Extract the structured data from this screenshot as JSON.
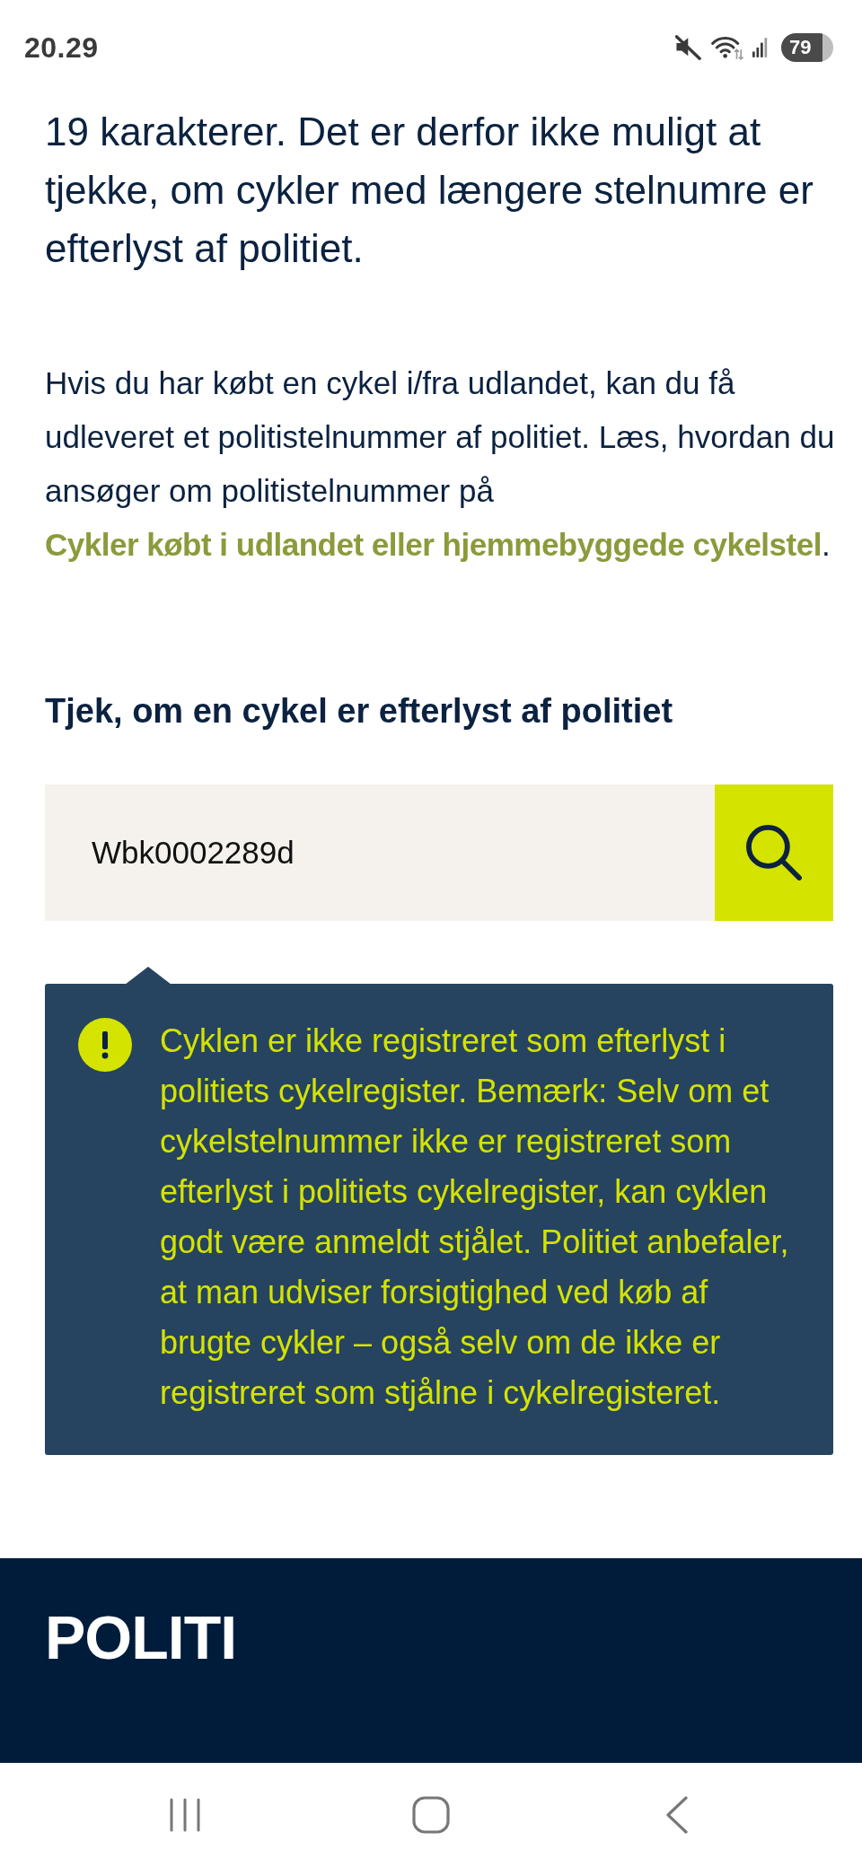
{
  "status_bar": {
    "time": "20.29",
    "battery": "79"
  },
  "intro": {
    "text": "19 karakterer. Det er derfor ikke muligt at tjekke, om cykler med længere stelnumre er efterlyst af politiet."
  },
  "paragraph": {
    "before": "Hvis du har købt en cykel i/fra udlandet, kan du få udleveret et politistelnummer af politiet. Læs, hvordan du ansøger om politistelnummer på",
    "link": "Cykler købt i udlandet eller hjemmebyggede cykelstel",
    "after": "."
  },
  "search": {
    "heading": "Tjek, om en cykel er efterlyst af politiet",
    "value": "Wbk0002289d"
  },
  "alert": {
    "kind": "warning",
    "text": "Cyklen er ikke registreret som efterlyst i politiets cykelregister. Bemærk: Selv om et cykelstelnummer ikke er registreret som efterlyst i politiets cykelregister, kan cyklen godt være anmeldt stjålet. Politiet anbefaler, at man udviser forsigtighed ved køb af brugte cykler – også selv om de ikke er registreret som stjålne i cykelregisteret."
  },
  "footer": {
    "logo": "POLITI"
  }
}
